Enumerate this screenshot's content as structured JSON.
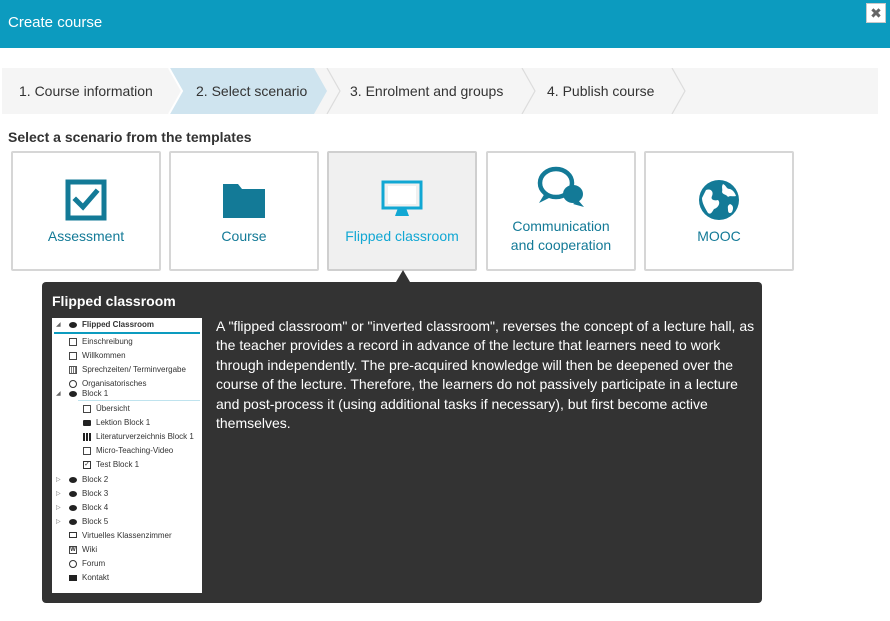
{
  "dialog": {
    "title": "Create course",
    "close_glyph": "✖"
  },
  "wizard": {
    "steps": [
      {
        "label": "1. Course information",
        "active": false
      },
      {
        "label": "2. Select scenario",
        "active": true
      },
      {
        "label": "3. Enrolment and groups",
        "active": false
      },
      {
        "label": "4. Publish course",
        "active": false
      }
    ]
  },
  "section": {
    "heading": "Select a scenario from the templates"
  },
  "scenarios": [
    {
      "label": "Assessment",
      "icon": "checkbox-icon"
    },
    {
      "label": "Course",
      "icon": "folder-icon"
    },
    {
      "label": "Flipped classroom",
      "icon": "monitor-icon",
      "selected": true
    },
    {
      "label_line1": "Communication",
      "label_line2": "and cooperation",
      "icon": "chat-bubbles-icon"
    },
    {
      "label": "MOOC",
      "icon": "globe-icon"
    }
  ],
  "tooltip": {
    "title": "Flipped classroom",
    "description": "A \"flipped classroom\" or \"inverted classroom\", reverses the concept of a lecture hall, as the teacher provides a record in advance of the lecture that learners need to work through independently. The pre-acquired knowledge will then be deepened over the course of the lecture. Therefore, the learners do not passively participate in a lecture and post-process it (using additional tasks if necessary), but first become active themselves.",
    "tree": [
      {
        "label": "Flipped Classroom",
        "icon": "course-icon",
        "arrow": "◢"
      },
      {
        "label": "Einschreibung",
        "icon": "enrolment-icon"
      },
      {
        "label": "Willkommen",
        "icon": "page-icon"
      },
      {
        "label": "Sprechzeiten/ Terminvergabe",
        "icon": "calendar-icon"
      },
      {
        "label": "Organisatorisches",
        "icon": "forum-icon"
      },
      {
        "label": "Block 1",
        "icon": "structure-icon",
        "arrow": "◢"
      },
      {
        "label": "Übersicht",
        "icon": "page-icon"
      },
      {
        "label": "Lektion Block 1",
        "icon": "folder-icon"
      },
      {
        "label": "Literaturverzeichnis Block 1",
        "icon": "literature-icon"
      },
      {
        "label": "Micro-Teaching-Video",
        "icon": "page-icon"
      },
      {
        "label": "Test Block 1",
        "icon": "test-icon"
      },
      {
        "label": "Block 2",
        "icon": "structure-icon",
        "arrow": "▷"
      },
      {
        "label": "Block 3",
        "icon": "structure-icon",
        "arrow": "▷"
      },
      {
        "label": "Block 4",
        "icon": "structure-icon",
        "arrow": "▷"
      },
      {
        "label": "Block 5",
        "icon": "structure-icon",
        "arrow": "▷"
      },
      {
        "label": "Virtuelles Klassenzimmer",
        "icon": "monitor-icon"
      },
      {
        "label": "Wiki",
        "icon": "wiki-icon",
        "glyph": "W"
      },
      {
        "label": "Forum",
        "icon": "forum-icon"
      },
      {
        "label": "Kontakt",
        "icon": "mail-icon"
      }
    ]
  },
  "colors": {
    "header": "#0c9bbf",
    "accent_text": "#137a97",
    "selected_text": "#11a7d3",
    "tooltip_bg": "#333333"
  }
}
